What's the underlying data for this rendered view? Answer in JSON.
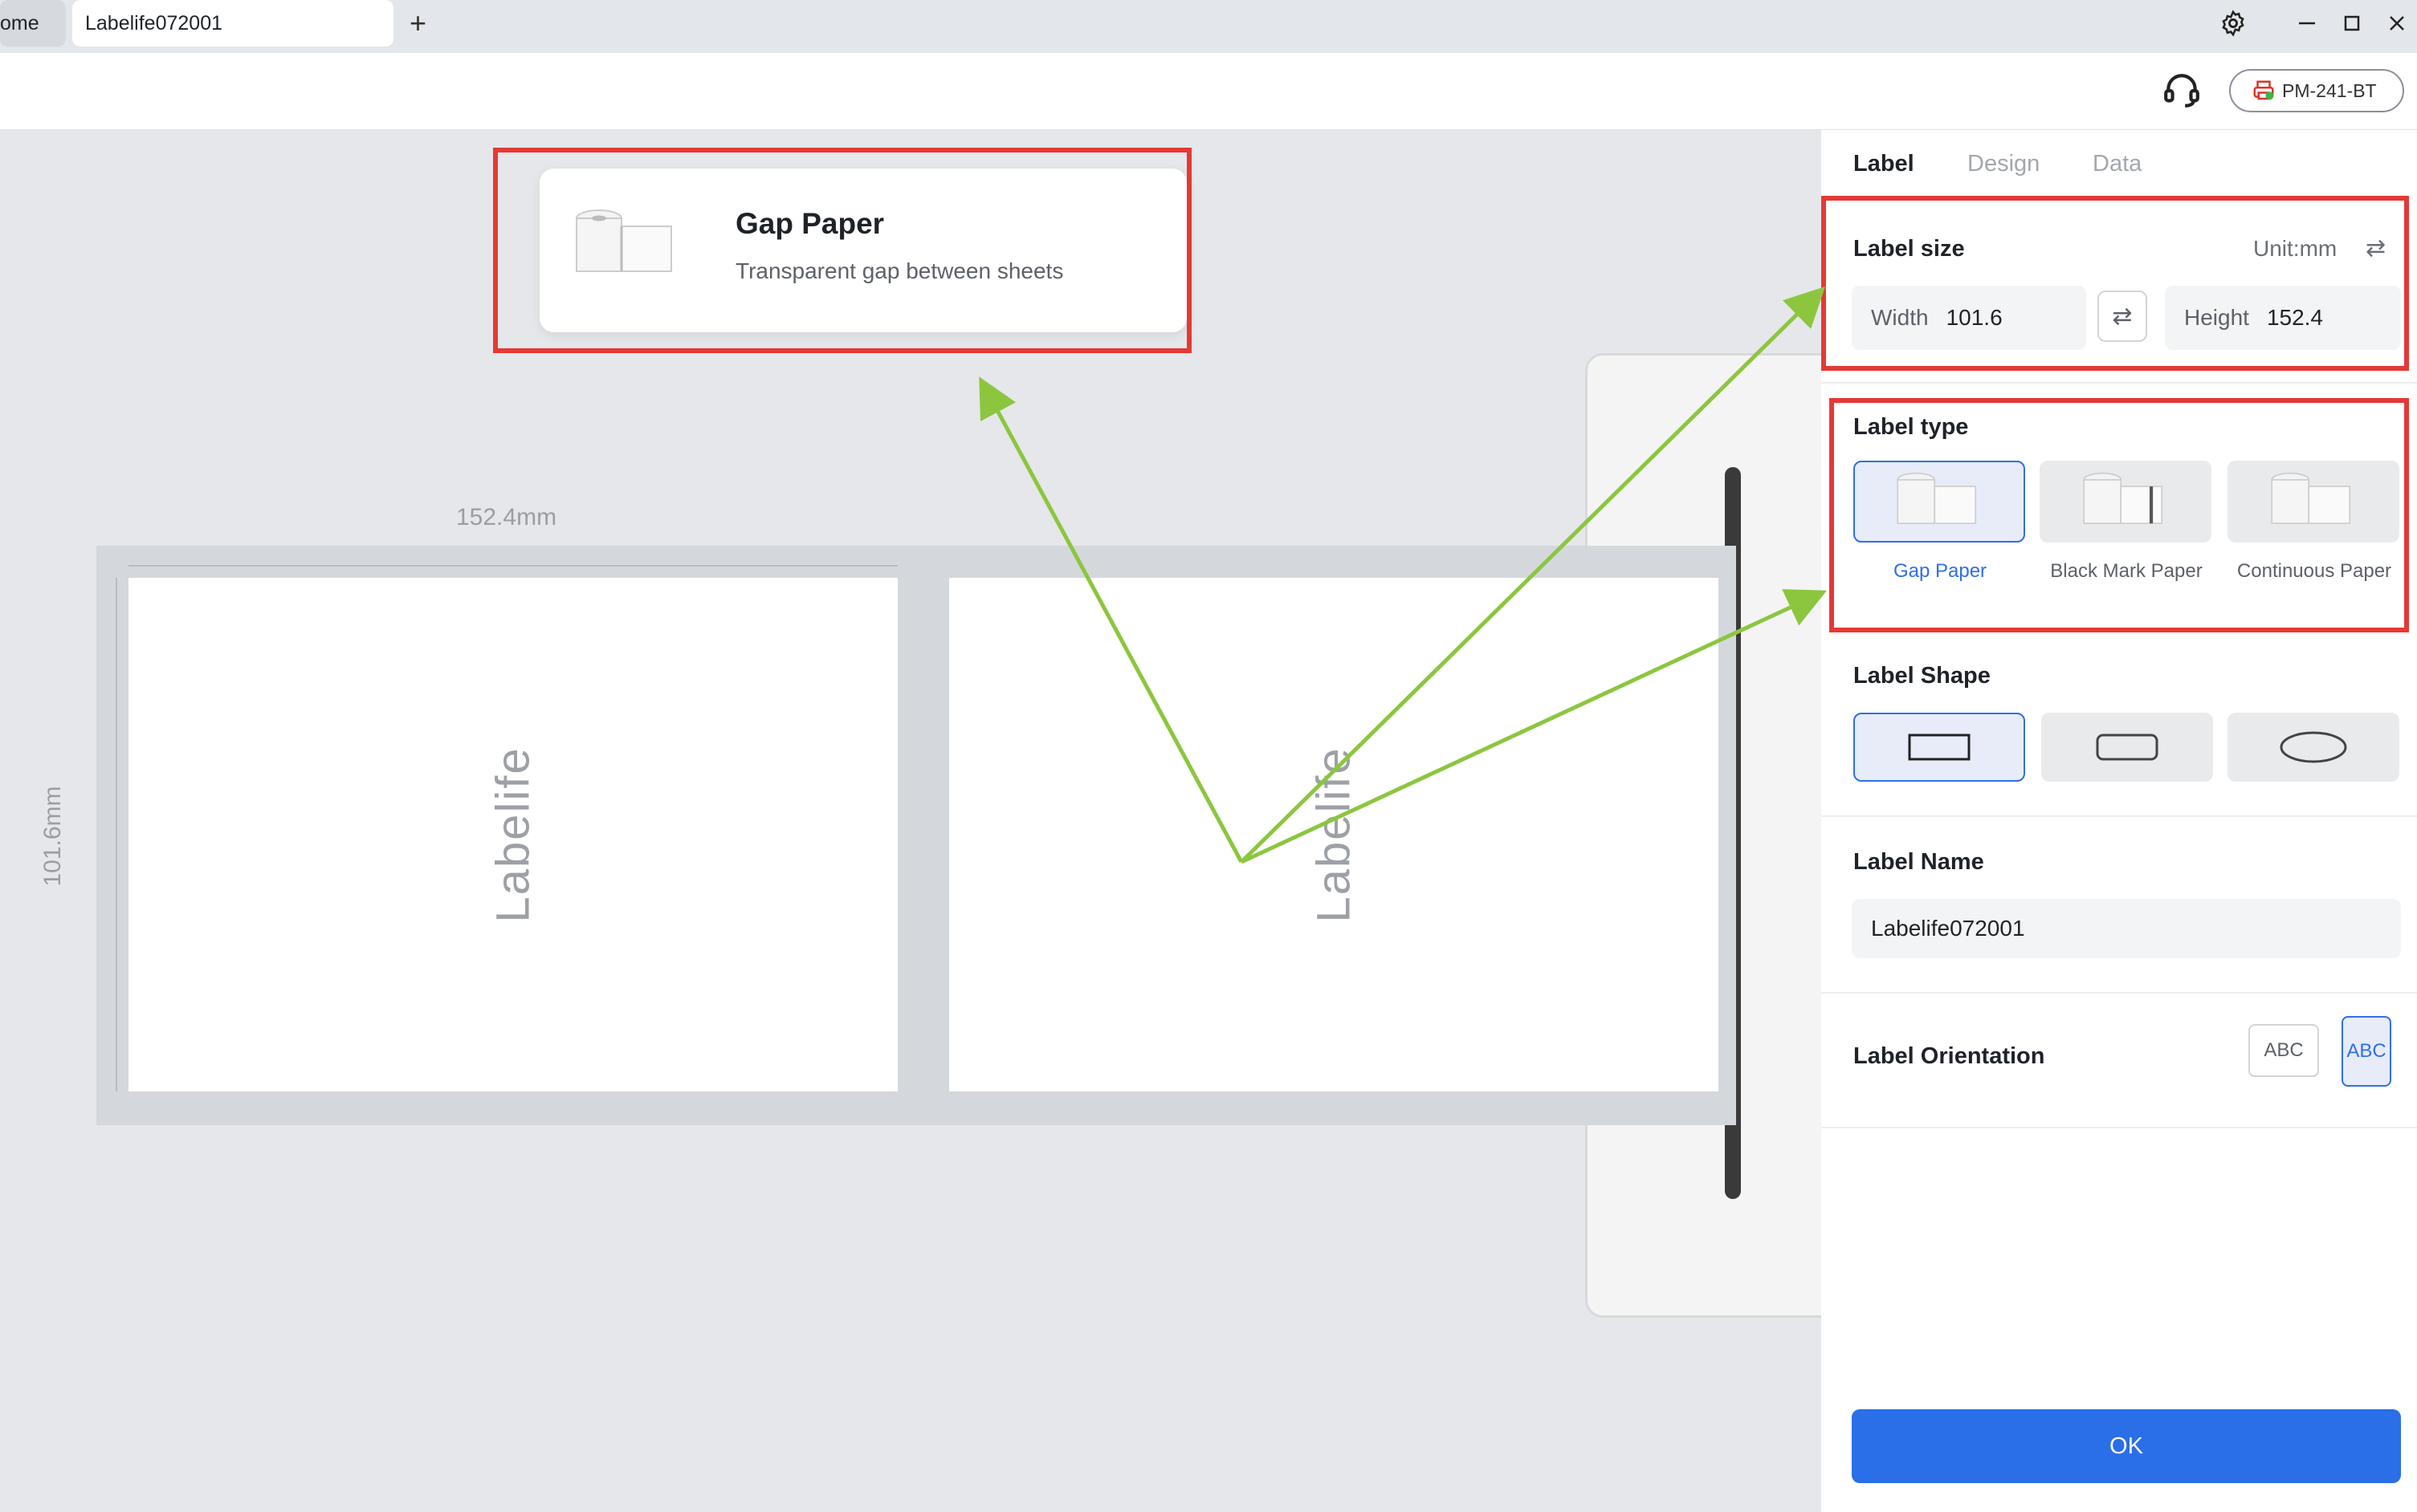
{
  "tabs": {
    "home": "ome",
    "active": "Labelife072001",
    "add": "+"
  },
  "toolbar": {
    "printer": "PM-241-BT"
  },
  "canvas": {
    "width_dim": "152.4mm",
    "height_dim": "101.6mm",
    "sheet_text": "Labelife"
  },
  "callout": {
    "title": "Gap Paper",
    "subtitle": "Transparent gap between sheets"
  },
  "panel": {
    "tabs": [
      "Label",
      "Design",
      "Data"
    ],
    "label_size": {
      "title": "Label size",
      "unit": "Unit:mm",
      "width_label": "Width",
      "width_value": "101.6",
      "height_label": "Height",
      "height_value": "152.4"
    },
    "label_type": {
      "title": "Label type",
      "options": [
        "Gap Paper",
        "Black Mark Paper",
        "Continuous Paper"
      ],
      "selected": "Gap Paper"
    },
    "label_shape": {
      "title": "Label Shape",
      "selected": "rectangle",
      "options": [
        "rectangle",
        "rounded-rectangle",
        "ellipse"
      ]
    },
    "label_name": {
      "title": "Label Name",
      "value": "Labelife072001"
    },
    "label_orientation": {
      "title": "Label Orientation",
      "options": [
        "ABC",
        "ABC"
      ]
    },
    "ok": "OK"
  },
  "colors": {
    "accent": "#2a6ee8",
    "highlight": "#e53935",
    "arrow": "#8cc63f"
  }
}
